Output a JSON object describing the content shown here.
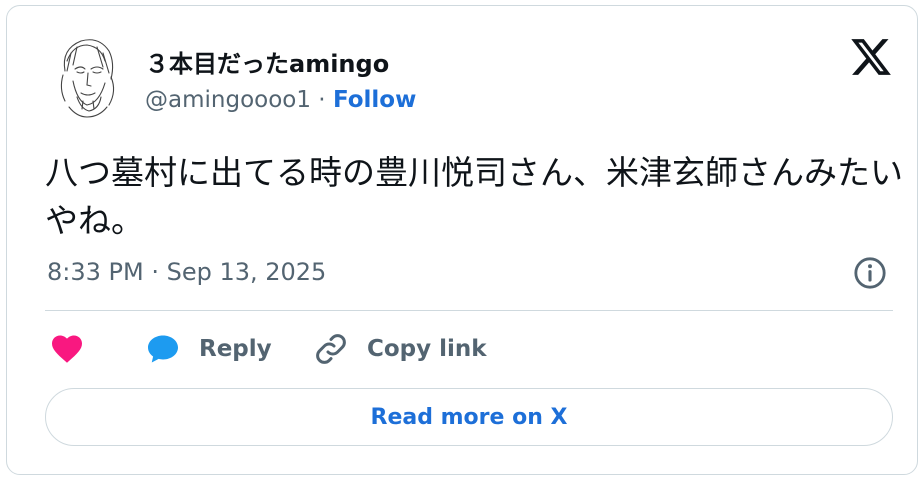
{
  "author": {
    "display_name": "３本目だったamingo",
    "handle": "@amingoooo1",
    "separator": " · ",
    "follow_label": "Follow"
  },
  "tweet": {
    "text": "八つ墓村に出てる時の豊川悦司さん、米津玄師さんみたいやね。",
    "timestamp": "8:33 PM · Sep 13, 2025"
  },
  "actions": {
    "like_label": "",
    "reply_label": "Reply",
    "copy_label": "Copy link"
  },
  "read_more_label": "Read more on X",
  "icons": {
    "brand": "x-logo-icon",
    "info": "info-icon",
    "like": "heart-icon",
    "reply": "speech-bubble-icon",
    "copy": "link-icon"
  },
  "colors": {
    "link": "#1d6fd8",
    "like": "#f91880",
    "reply": "#1d9bf0",
    "muted": "#536471",
    "text": "#0f1419",
    "border": "#cfd9de"
  }
}
